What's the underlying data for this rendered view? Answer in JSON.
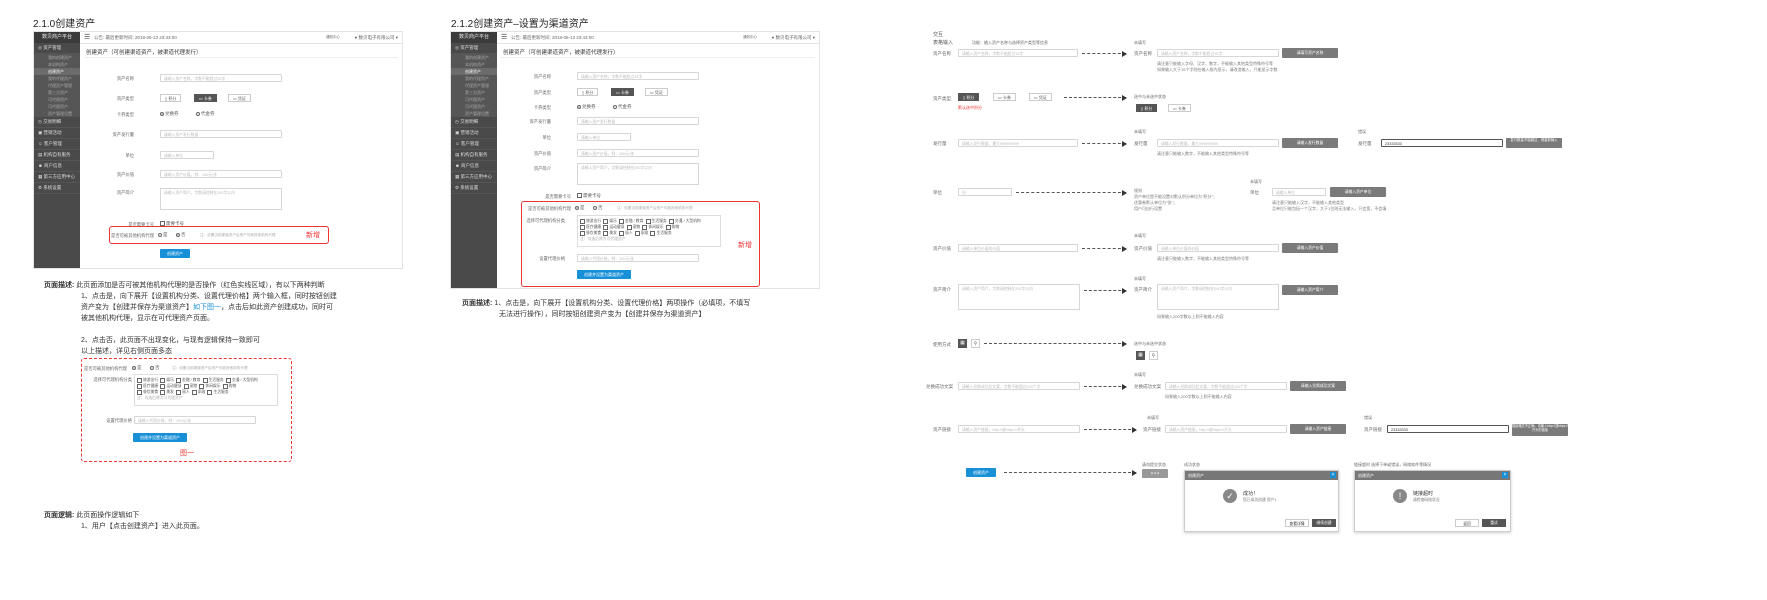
{
  "sections": {
    "s1_title": "2.1.0创建资产",
    "s2_title": "2.1.2创建资产–设置为渠道资产"
  },
  "app": {
    "platform": "数贝商户平台",
    "notice": "公告: 最后更新时间: 2018-05-13 23:43:00",
    "msg": "通知中心",
    "company": "数贝电子有限公司"
  },
  "sidebar": {
    "items": [
      "资产管理",
      "交易明细",
      "营销活动",
      "客户管理",
      "机构自有服务",
      "商户信息",
      "第三方应用中心",
      "系统设置"
    ],
    "subs": [
      "我的创建资产",
      "本机构资产",
      "创建资产",
      "我的代理资产",
      "代理资产管理",
      "第三方资产",
      "可代理资产",
      "可代理资产",
      "资产管理设置"
    ]
  },
  "form1": {
    "header": "创建资产（可创建渠道资产，被渠道代理发行）",
    "labels": [
      "资产名称",
      "资产类型",
      "卡券类型",
      "资产发行量",
      "单位",
      "资产价值",
      "资产简介",
      "是否需要卡号",
      "是否可被其他机构代理"
    ],
    "name_ph": "请输入资产名称，字数不能超过15字",
    "types": [
      "积分",
      "卡券",
      "凭证"
    ],
    "coupon_types": [
      "兑换券",
      "代金券"
    ],
    "issue_ph": "请输入资产发行数量",
    "unit_ph": "请输入单位",
    "value_ph": "请输入资产价值，例：100元/张",
    "intro_ph": "请输入资产简介，字数请控制在200字以内",
    "need_card": "需要卡号",
    "yes": "是",
    "no": "否",
    "agent_note": "注：设置当前渠道资产后资产可被其他机构代理",
    "new_tag": "新增",
    "create_btn": "创建资产"
  },
  "form2": {
    "header": "创建资产（可创建渠道资产，被渠道代理发行）",
    "labels": [
      "资产名称",
      "资产类型",
      "卡券类型",
      "资产发行量",
      "单位",
      "资产价值",
      "资产简介",
      "是否需要卡号",
      "是否可被其他机构代理",
      "选择可代理机构分类",
      "设置代理价格"
    ],
    "categories": [
      "旅游出行",
      "娱乐",
      "金融 / 教育",
      "生活服务",
      "交通 / 大型机构",
      "医疗健康",
      "运动健身",
      "宠物",
      "休闲娱乐",
      "购物",
      "餐饮美食",
      "美发",
      "丽人",
      "家政",
      "生活服务"
    ],
    "cat_note": "注：勾选后将为可代理资产",
    "price_ph": "请输入代理价格，例：100元/张",
    "save_btn": "创建并设置为渠道资产",
    "new_tag": "新增"
  },
  "desc1": {
    "label": "页面描述:",
    "line1": "此页面添加是否可被其他机构代理的是否操作（红色实线区域），有以下两种判断",
    "line2": "1、点击是，向下展开【设置机构分类、设置代理价格】两个输入框，同时按钮创建",
    "line3a": "资产变为【创建并保存为渠道资产】",
    "line3link": "如下图一",
    "line3b": "，点击后如此资产创建成功，同时可",
    "line4": "被其他机构代理，显示在可代理资产页面。",
    "line5": "2、点击否，此页面不出现变化，与现有逻辑保持一致即可",
    "line6": "以上描述，详见右侧页面多态",
    "fig_label": "图一",
    "logic_label": "页面逻辑:",
    "logic1": "此页面操作逻辑如下",
    "logic2": "1、用户【点击创建资产】进入此页面。"
  },
  "desc2": {
    "label": "页面描述:",
    "line1": "1、点击是，向下展开【设置机构分类、设置代理价格】两项操作（必填项，不填写",
    "line2": "无法进行操作），同时按钮创建资产变为【创建并保存为渠道资产】"
  },
  "states": {
    "h_interact": "交互",
    "h_input": "表格输入",
    "h_func": "功能：输入资产名称与选择资产类型等信息",
    "unfilled": "未填写",
    "error": "错误",
    "click_state": "选中与未选中状态",
    "name": {
      "label": "资产名称",
      "ph": "请输入资产名称，字数不能超过15字",
      "err_btn": "请填写资产名称",
      "hint1": "请注意只能输入字母、汉字、数字，不能输入其他类型特殊符号等",
      "hint2": "如果输入大于15个字则在输入框内显示，请改造输入，只能显示字数"
    },
    "type": {
      "label": "资产类型",
      "tabs": [
        "积分",
        "卡券",
        "凭证"
      ],
      "default": "默认选中积分",
      "sel": [
        "积分",
        "卡券"
      ]
    },
    "issue": {
      "label": "发行量",
      "ph": "请输入发行数量，最大999999999",
      "err_btn": "请输入发行数量",
      "hint": "请注意只能输入数字，不能输入其他类型特殊符号等",
      "err_val": "23333333",
      "err_msg": "发行数量不能超过，请重新输入"
    },
    "unit": {
      "label": "单位",
      "ph": "份",
      "n1": "规则",
      "n2": "资产单位是不能设置对默认积分单位为\"积分\"；",
      "n3": "优惠卷默认单位为\"张\"；",
      "n4": "用户可自行设置",
      "unit_label": "单位",
      "unit_ph": "请输入单位",
      "unit_btn": "请输入资产单位",
      "hint1": "请注意只能输入汉字，不能输入其他类型",
      "hint2": "且单位只能包括一个汉字，大于1位则无法输入，只会宽，不会填"
    },
    "value": {
      "label": "资产价值",
      "ph": "请输入单位价值的价值",
      "btn": "请输入资产价值",
      "hint": "请注意只能输入数字，不能输入其他类型特殊符号等"
    },
    "intro": {
      "label": "资产简介",
      "ph": "请输入资产简介，字数请控制在200字以内",
      "btn": "请输入资产简介",
      "hint": "如果输入200字数以上则不能输入内容"
    },
    "mode": {
      "label": "使用方式"
    },
    "success": {
      "label": "兑换成功文案",
      "ph": "请输入兑换成功后文案，字数不能超过200个字",
      "btn": "请输入兑换成功文案",
      "hint": "如果输入200字数以上则不能输入内容"
    },
    "link": {
      "label": "资产链接",
      "ph": "请输入资产链接，http://或https://开头",
      "btn": "请输入资产链接",
      "err_val": "23333333",
      "err_msg": "链接格式不正确，请输入http://或https://开头的链接"
    },
    "submit": {
      "btn": "创建资产",
      "loading": "请勿提交状态",
      "success_state": "成功状态",
      "fail_state": "链接超时  选择下单或错误，网络软件等情况",
      "dlg_title": "创建资产",
      "ok_title": "成功！",
      "ok_msg": "您已成功创建 资产1",
      "ok_b1": "查看详情",
      "ok_b2": "继续创建",
      "fail_title": "链接超时",
      "fail_msg": "请检查网络状况",
      "fail_b1": "返回",
      "fail_b2": "重试",
      "dots": "● ● ●"
    }
  }
}
